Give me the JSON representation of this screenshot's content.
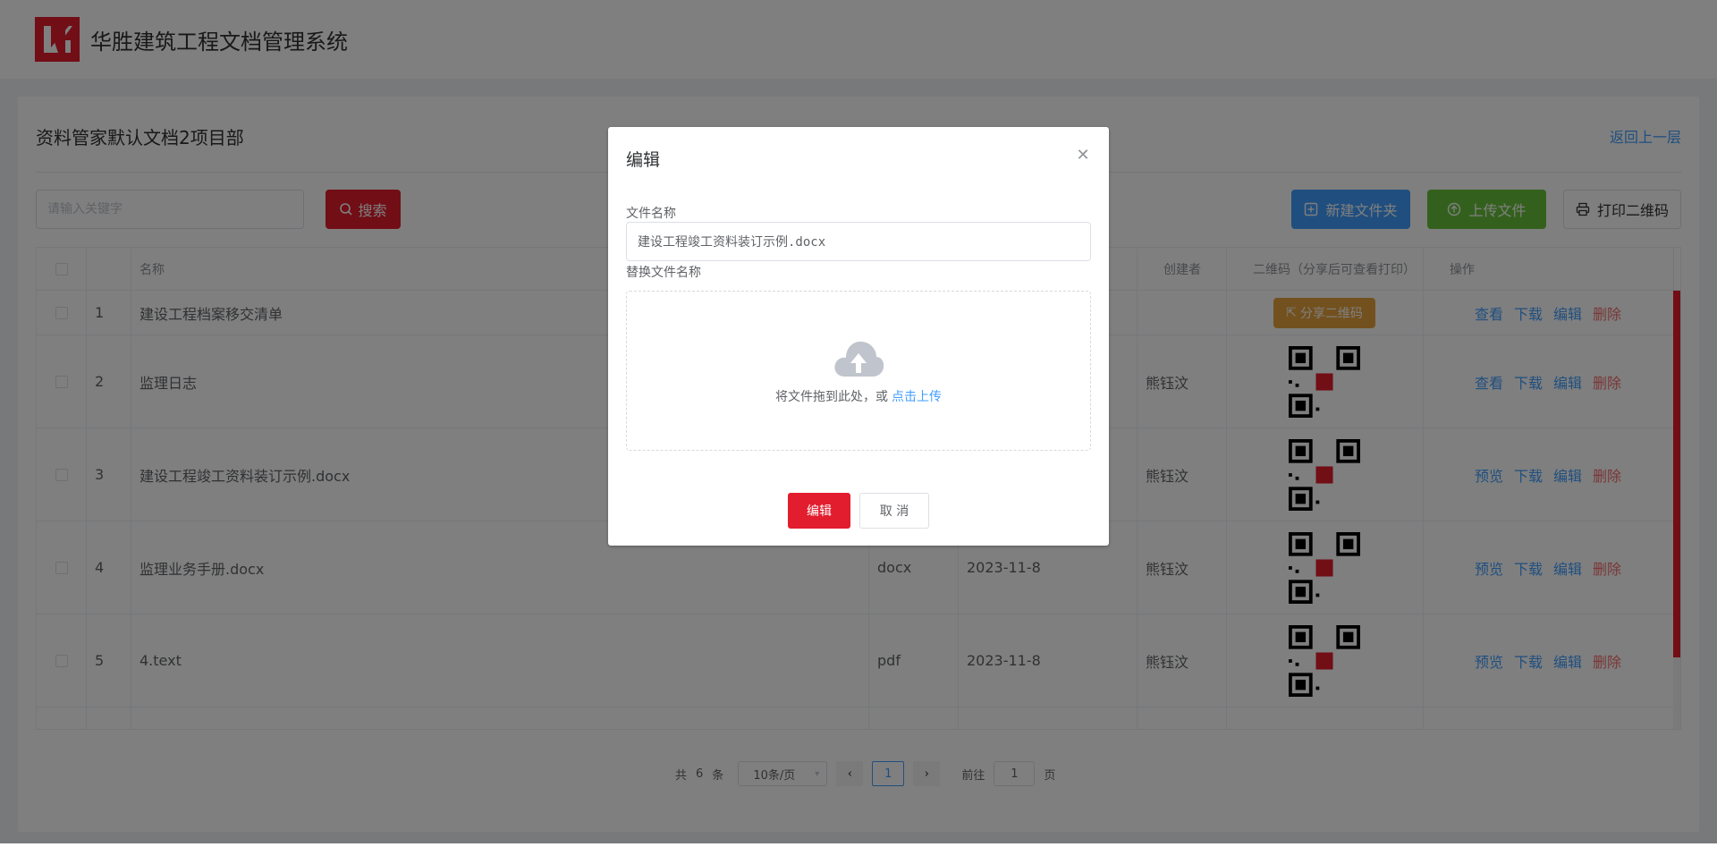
{
  "header": {
    "title": "华胜建筑工程文档管理系统"
  },
  "page": {
    "title": "资料管家默认文档2项目部",
    "back_label": "返回上一层"
  },
  "toolbar": {
    "search_placeholder": "请输入关键字",
    "search_label": "搜索",
    "new_folder_label": "新建文件夹",
    "upload_label": "上传文件",
    "print_qr_label": "打印二维码"
  },
  "table": {
    "columns": {
      "name": "名称",
      "creator": "创建者",
      "qrcode": "二维码（分享后可查看打印）",
      "actions": "操作"
    },
    "share_label": "分享二维码",
    "rows": [
      {
        "index": "1",
        "name": "建设工程档案移交清单",
        "type": "",
        "date": "",
        "creator": "",
        "qr": "share",
        "actions": [
          "查看",
          "下载",
          "编辑",
          "删除"
        ]
      },
      {
        "index": "2",
        "name": "监理日志",
        "type": "",
        "date": "",
        "creator": "熊钰汶",
        "qr": "code",
        "actions": [
          "查看",
          "下载",
          "编辑",
          "删除"
        ]
      },
      {
        "index": "3",
        "name": "建设工程竣工资料装订示例.docx",
        "type": "",
        "date": "",
        "creator": "熊钰汶",
        "qr": "code",
        "actions": [
          "预览",
          "下载",
          "编辑",
          "删除"
        ]
      },
      {
        "index": "4",
        "name": "监理业务手册.docx",
        "type": "docx",
        "date": "2023-11-8",
        "creator": "熊钰汶",
        "qr": "code",
        "actions": [
          "预览",
          "下载",
          "编辑",
          "删除"
        ]
      },
      {
        "index": "5",
        "name": "4.text",
        "type": "pdf",
        "date": "2023-11-8",
        "creator": "熊钰汶",
        "qr": "code",
        "actions": [
          "预览",
          "下载",
          "编辑",
          "删除"
        ]
      }
    ]
  },
  "pagination": {
    "total_prefix": "共",
    "total": "6",
    "total_suffix": "条",
    "page_size": "10条/页",
    "current_page": "1",
    "goto_prefix": "前往",
    "goto_value": "1",
    "goto_suffix": "页"
  },
  "dialog": {
    "title": "编辑",
    "file_name_label": "文件名称",
    "file_name_value": "建设工程竣工资料装订示例.docx",
    "replace_label": "替换文件名称",
    "upload_hint": "将文件拖到此处，或",
    "upload_link": "点击上传",
    "confirm_label": "编辑",
    "cancel_label": "取 消"
  },
  "colors": {
    "brand_red": "#e21d2d",
    "primary_blue": "#409eff",
    "success_green": "#67c23a",
    "warning_orange": "#e6a23c"
  }
}
